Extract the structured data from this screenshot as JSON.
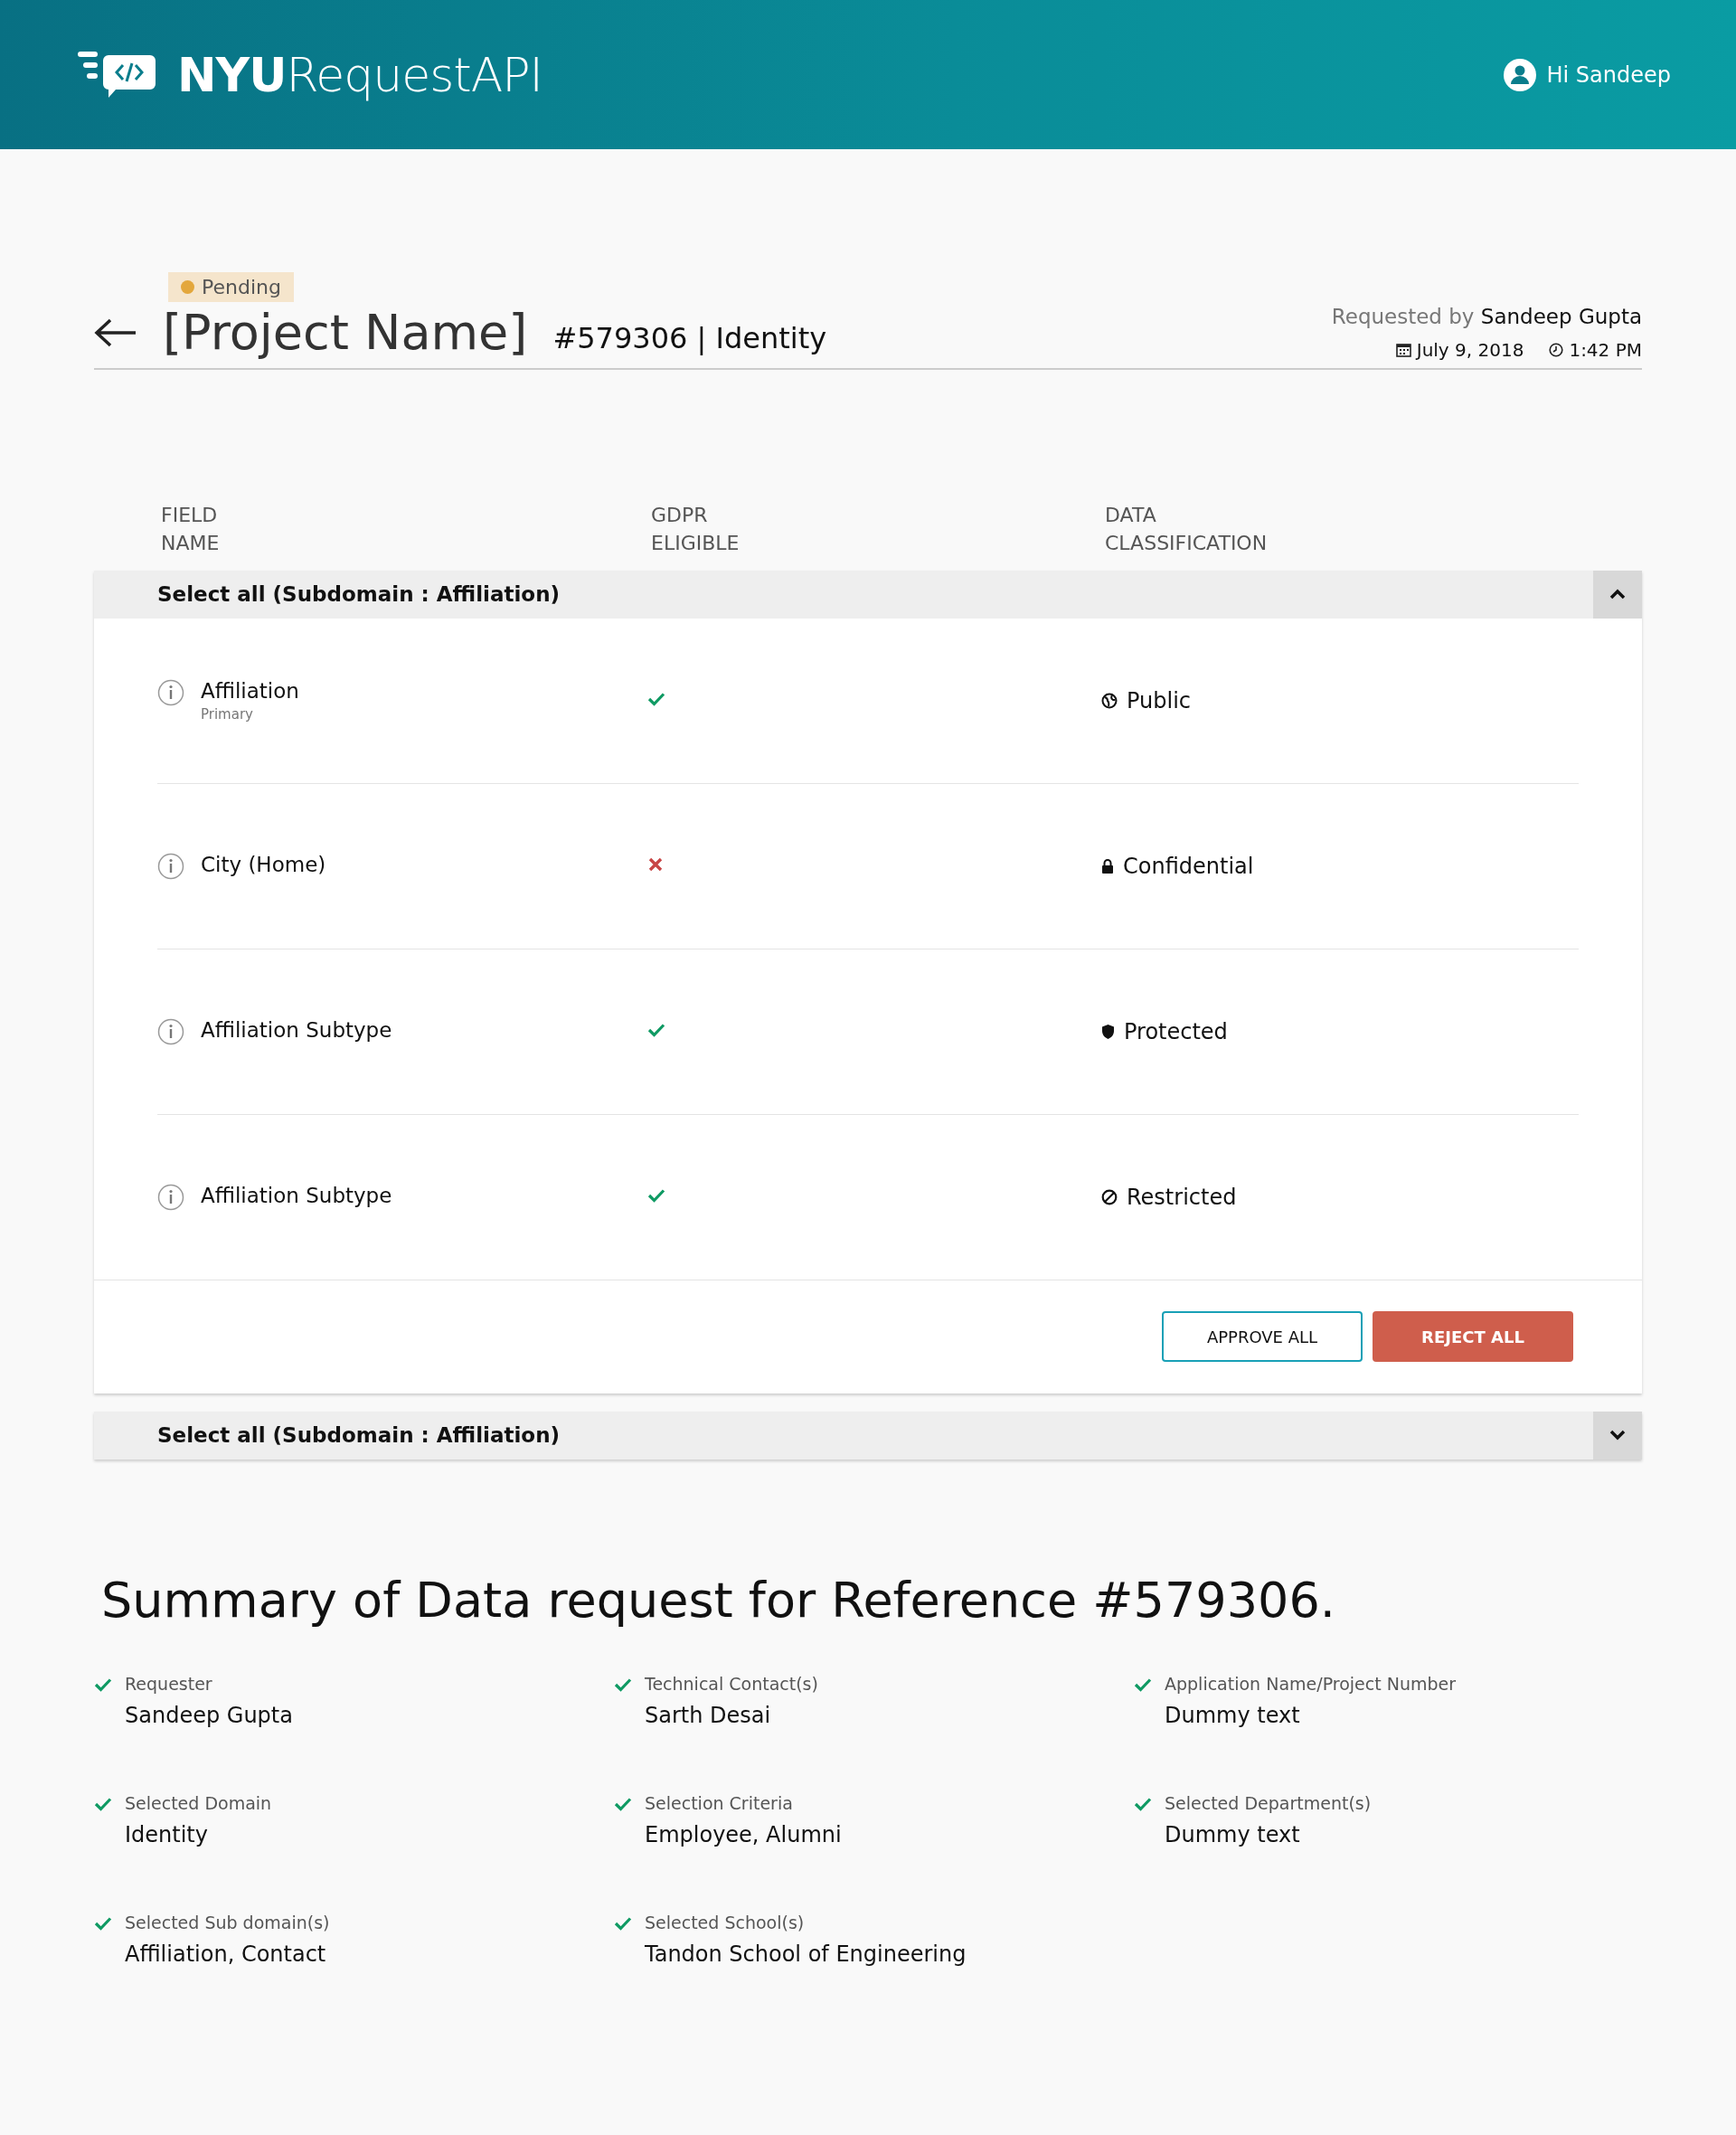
{
  "header": {
    "brand_bold": "NYU",
    "brand_light": "RequestAPI",
    "user_greeting": "Hi Sandeep"
  },
  "request": {
    "status": {
      "label": "Pending",
      "kind": "pending"
    },
    "title": "[Project Name]",
    "reference": "#579306 | Identity",
    "requested_by_label": "Requested by",
    "requested_by": "Sandeep Gupta",
    "date": "July 9, 2018",
    "time": "1:42 PM"
  },
  "table": {
    "columns": [
      "FIELD\nNAME",
      "GDPR\nELIGIBLE",
      "DATA\nCLASSIFICATION"
    ],
    "sections": [
      {
        "title": "Select all (Subdomain : Affiliation)",
        "expanded": true,
        "rows": [
          {
            "field": "Affiliation",
            "subtitle": "Primary",
            "gdpr_eligible": true,
            "classification": "Public",
            "kind": "public"
          },
          {
            "field": "City (Home)",
            "gdpr_eligible": false,
            "classification": "Confidential",
            "kind": "confidential"
          },
          {
            "field": "Affiliation Subtype",
            "gdpr_eligible": true,
            "classification": "Protected",
            "kind": "protected"
          },
          {
            "field": "Affiliation Subtype",
            "gdpr_eligible": true,
            "classification": "Restricted",
            "kind": "restricted"
          }
        ],
        "buttons": [
          "APPROVE ALL",
          "REJECT ALL"
        ]
      },
      {
        "title": "Select all (Subdomain : Affiliation)",
        "expanded": false
      }
    ]
  },
  "summary": {
    "title": "Summary of Data request for Reference #579306.",
    "items": [
      {
        "label": "Requester",
        "value": "Sandeep Gupta"
      },
      {
        "label": "Technical Contact(s)",
        "value": "Sarth Desai"
      },
      {
        "label": "Application Name/Project Number",
        "value": "Dummy text"
      },
      {
        "label": "Selected Domain",
        "value": "Identity"
      },
      {
        "label": "Selection Criteria",
        "value": "Employee, Alumni"
      },
      {
        "label": "Selected Department(s)",
        "value": "Dummy text"
      },
      {
        "label": "Selected Sub domain(s)",
        "value": "Affiliation, Contact"
      },
      {
        "label": "Selected School(s)",
        "value": "Tandon School of Engineering"
      }
    ]
  }
}
